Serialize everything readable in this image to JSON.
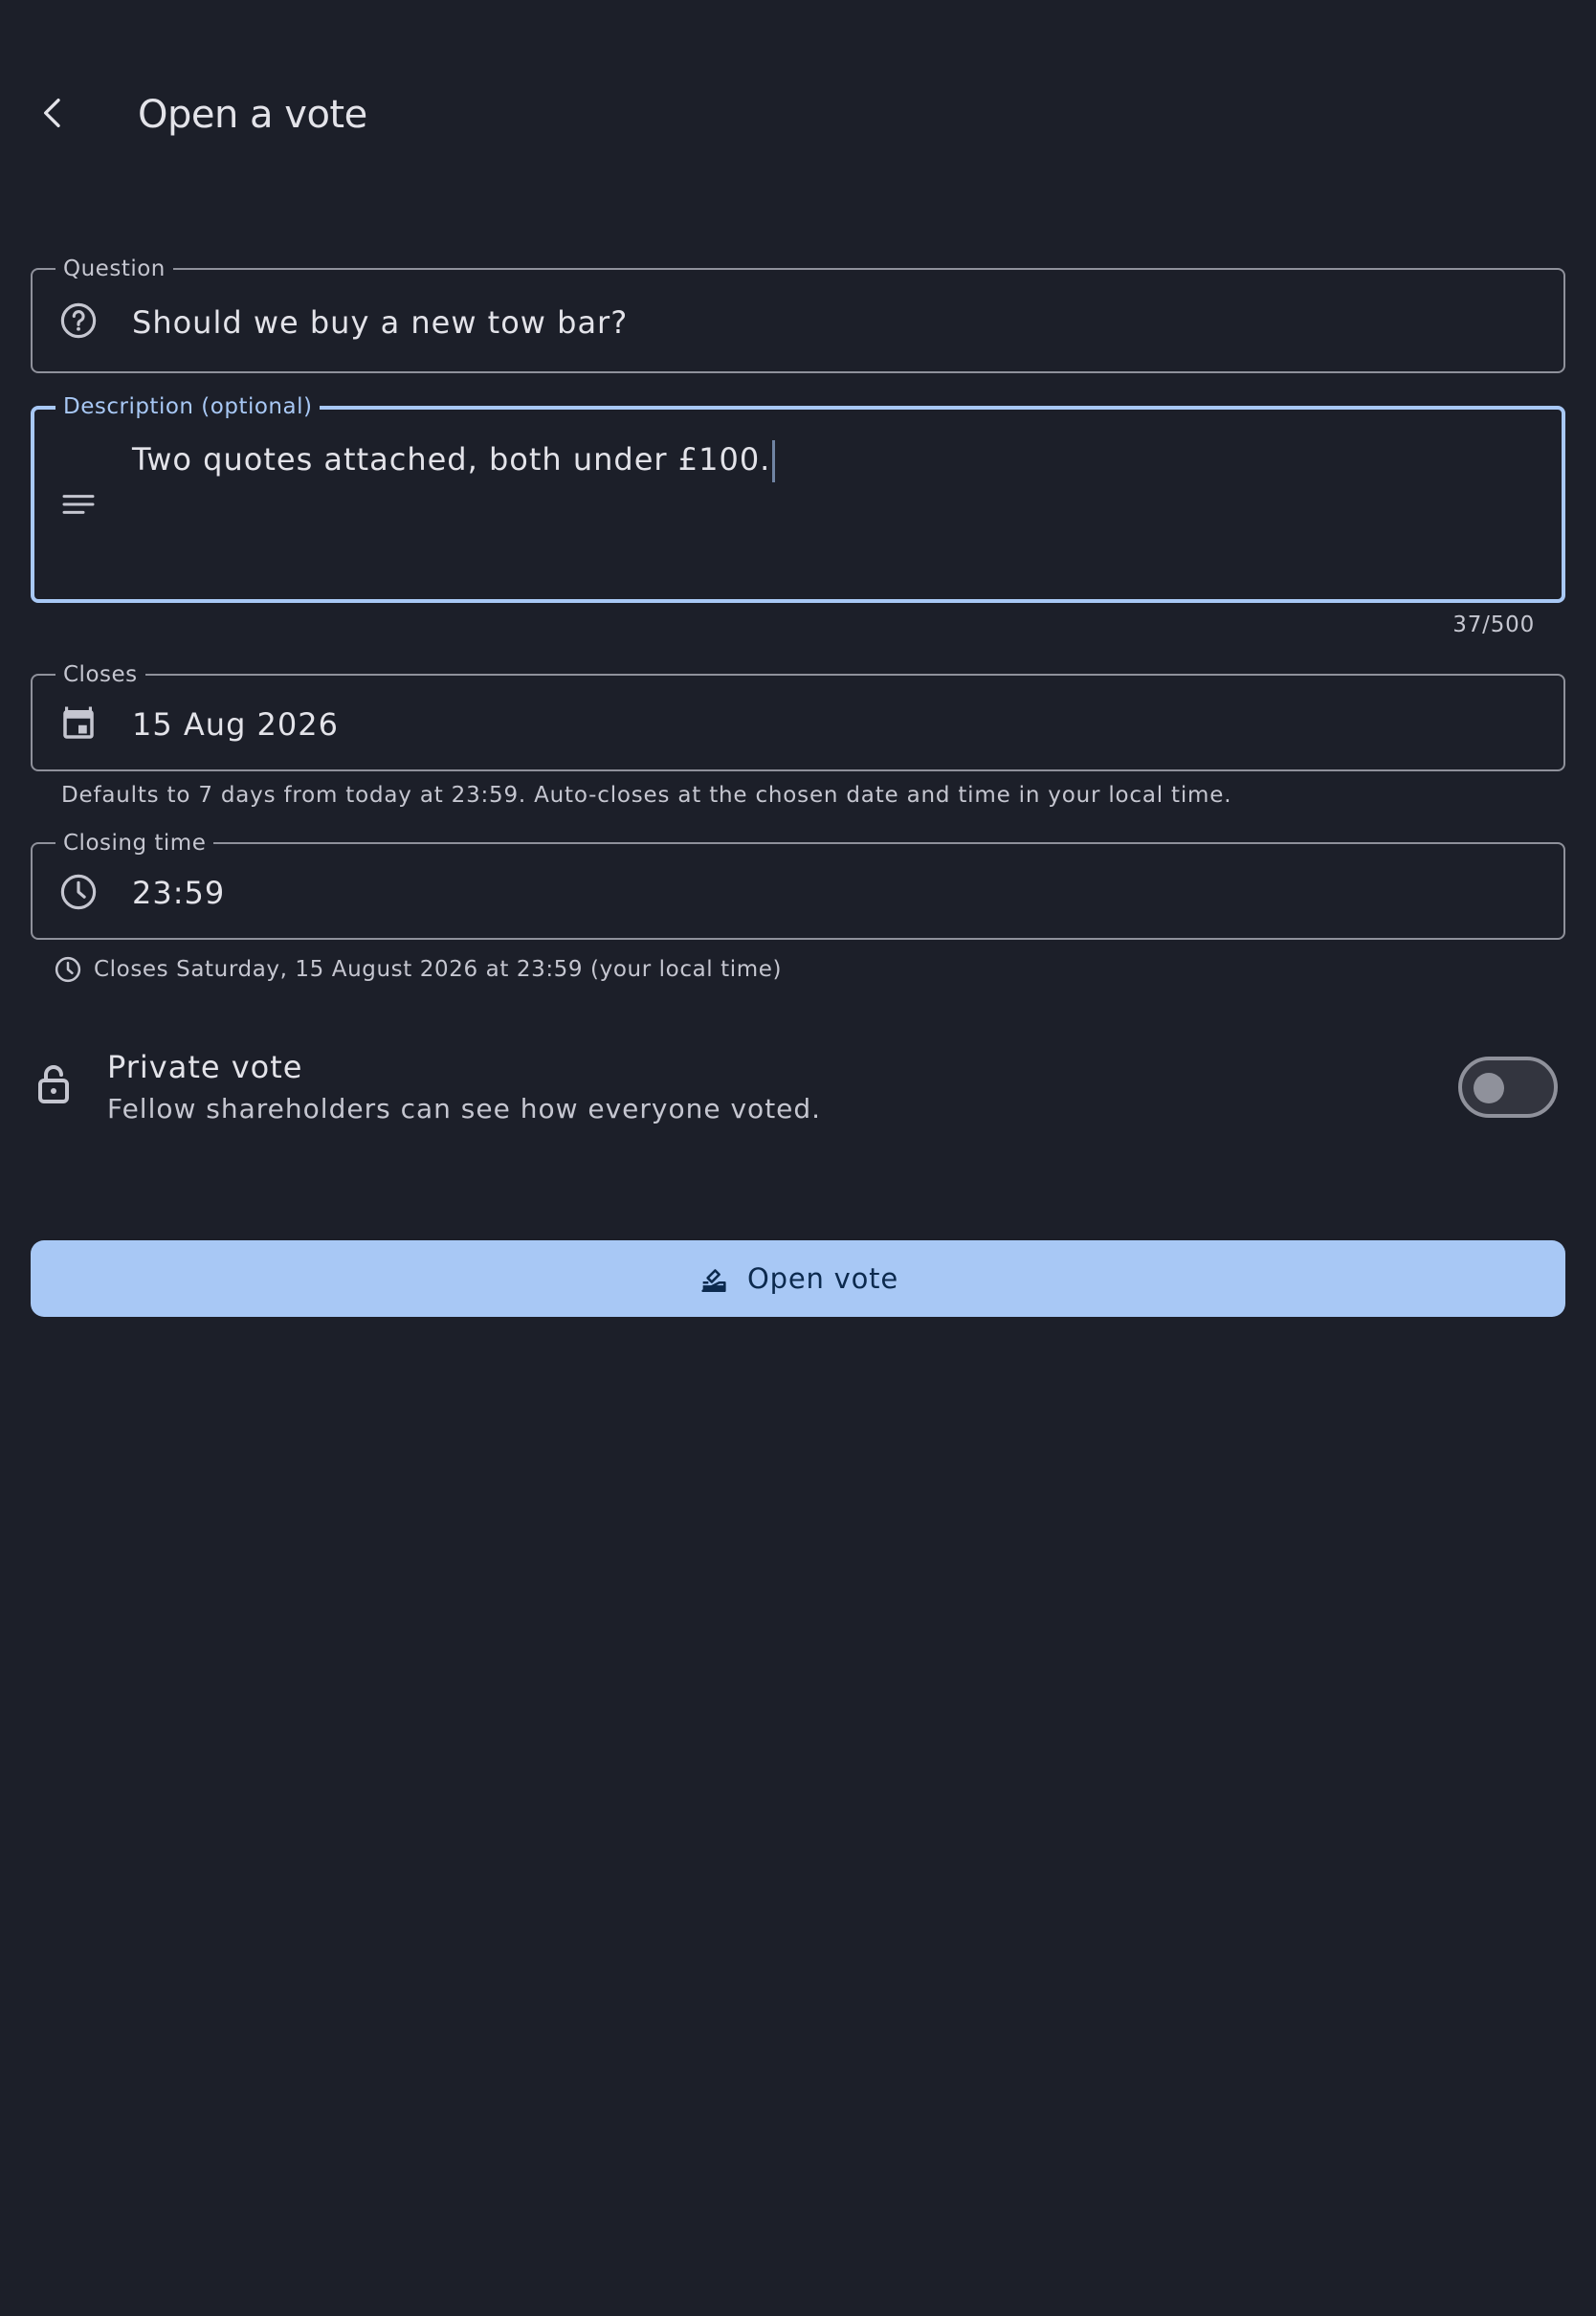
{
  "header": {
    "back_icon": "arrow-back-icon",
    "title": "Open a vote"
  },
  "form": {
    "question": {
      "label": "Question",
      "icon": "help-circle-icon",
      "value": "Should we buy a new tow bar?"
    },
    "description": {
      "label": "Description (optional)",
      "icon": "notes-icon",
      "value": "Two quotes attached, both under £100.",
      "counter": "37/500",
      "focused": true
    },
    "closes": {
      "label": "Closes",
      "icon": "calendar-icon",
      "value": "15 Aug 2026",
      "helper": "Defaults to 7 days from today at 23:59. Auto-closes at the chosen date and time in your local time."
    },
    "closing_time": {
      "label": "Closing time",
      "icon": "clock-icon",
      "value": "23:59",
      "summary": "Closes Saturday, 15 August 2026 at 23:59 (your local time)"
    },
    "private_vote": {
      "icon": "lock-open-icon",
      "title": "Private vote",
      "subtitle": "Fellow shareholders can see how everyone voted.",
      "enabled": false
    },
    "submit": {
      "icon": "ballot-icon",
      "label": "Open vote"
    }
  },
  "colors": {
    "background": "#1c1f29",
    "primary": "#a8c8f5",
    "outline": "#8f919b",
    "on_surface": "#e3e3e9",
    "on_surface_variant": "#c5c6d0"
  }
}
